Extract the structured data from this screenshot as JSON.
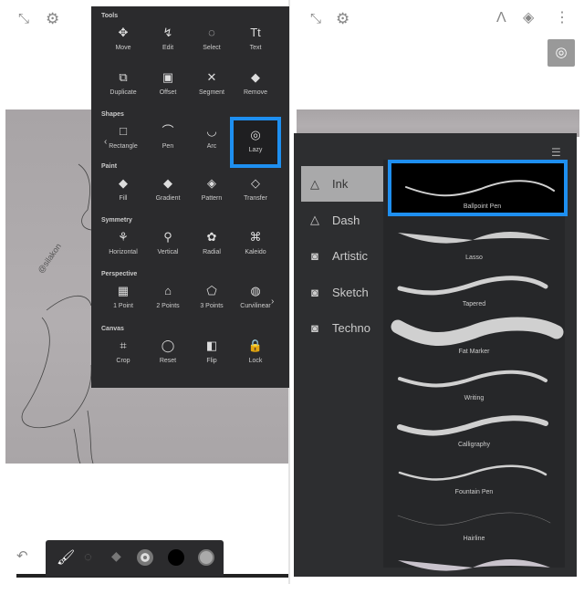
{
  "left": {
    "top_icons": [
      "fullscreen-icon",
      "settings-icon"
    ],
    "signature": "@silakon 21-06-22",
    "tools_panel": {
      "sections": [
        {
          "title": "Tools",
          "items": [
            {
              "label": "Move",
              "icon": "✥"
            },
            {
              "label": "Edit",
              "icon": "↯"
            },
            {
              "label": "Select",
              "icon": "◌"
            },
            {
              "label": "Text",
              "icon": "Tt"
            },
            {
              "label": "Duplicate",
              "icon": "⧉"
            },
            {
              "label": "Offset",
              "icon": "▣"
            },
            {
              "label": "Segment",
              "icon": "✕"
            },
            {
              "label": "Remove",
              "icon": "◆"
            }
          ]
        },
        {
          "title": "Shapes",
          "items": [
            {
              "label": "Rectangle",
              "icon": "□"
            },
            {
              "label": "Pen",
              "icon": "⌒"
            },
            {
              "label": "Arc",
              "icon": "◡"
            },
            {
              "label": "Lazy",
              "icon": "◎",
              "selected": true
            }
          ]
        },
        {
          "title": "Paint",
          "items": [
            {
              "label": "Fill",
              "icon": "◆"
            },
            {
              "label": "Gradient",
              "icon": "◆"
            },
            {
              "label": "Pattern",
              "icon": "◈"
            },
            {
              "label": "Transfer",
              "icon": "◇"
            }
          ]
        },
        {
          "title": "Symmetry",
          "items": [
            {
              "label": "Horizontal",
              "icon": "⚘"
            },
            {
              "label": "Vertical",
              "icon": "⚲"
            },
            {
              "label": "Radial",
              "icon": "✿"
            },
            {
              "label": "Kaleido",
              "icon": "⌘"
            }
          ]
        },
        {
          "title": "Perspective",
          "items": [
            {
              "label": "1 Point",
              "icon": "▦"
            },
            {
              "label": "2 Points",
              "icon": "⌂"
            },
            {
              "label": "3 Points",
              "icon": "⬠"
            },
            {
              "label": "Curvilinear",
              "icon": "◍"
            }
          ]
        },
        {
          "title": "Canvas",
          "items": [
            {
              "label": "Crop",
              "icon": "⌗"
            },
            {
              "label": "Reset",
              "icon": "◯"
            },
            {
              "label": "Flip",
              "icon": "◧"
            },
            {
              "label": "Lock",
              "icon": "🔒"
            }
          ]
        }
      ],
      "prev_arrow": "‹",
      "next_arrow": "›"
    },
    "undo_icon": "↶",
    "toolbar": {
      "active_tool": "brush",
      "color": "#000000",
      "accent": "#1e8ff0"
    }
  },
  "right": {
    "top_icons": [
      "fullscreen-icon",
      "settings-icon",
      "ruler-icon",
      "layers-icon",
      "more-icon"
    ],
    "lazy_button_icon": "◎",
    "categories": [
      {
        "label": "Ink",
        "icon": "△",
        "selected": true
      },
      {
        "label": "Dash",
        "icon": "△"
      },
      {
        "label": "Artistic",
        "icon": "◙"
      },
      {
        "label": "Sketch",
        "icon": "◙"
      },
      {
        "label": "Techno",
        "icon": "◙"
      }
    ],
    "brushes": [
      {
        "label": "Ballpoint Pen",
        "selected": true
      },
      {
        "label": "Lasso"
      },
      {
        "label": "Tapered"
      },
      {
        "label": "Fat Marker"
      },
      {
        "label": "Writing"
      },
      {
        "label": "Calligraphy"
      },
      {
        "label": "Fountain Pen"
      },
      {
        "label": "Hairline"
      },
      {
        "label": ""
      }
    ]
  }
}
